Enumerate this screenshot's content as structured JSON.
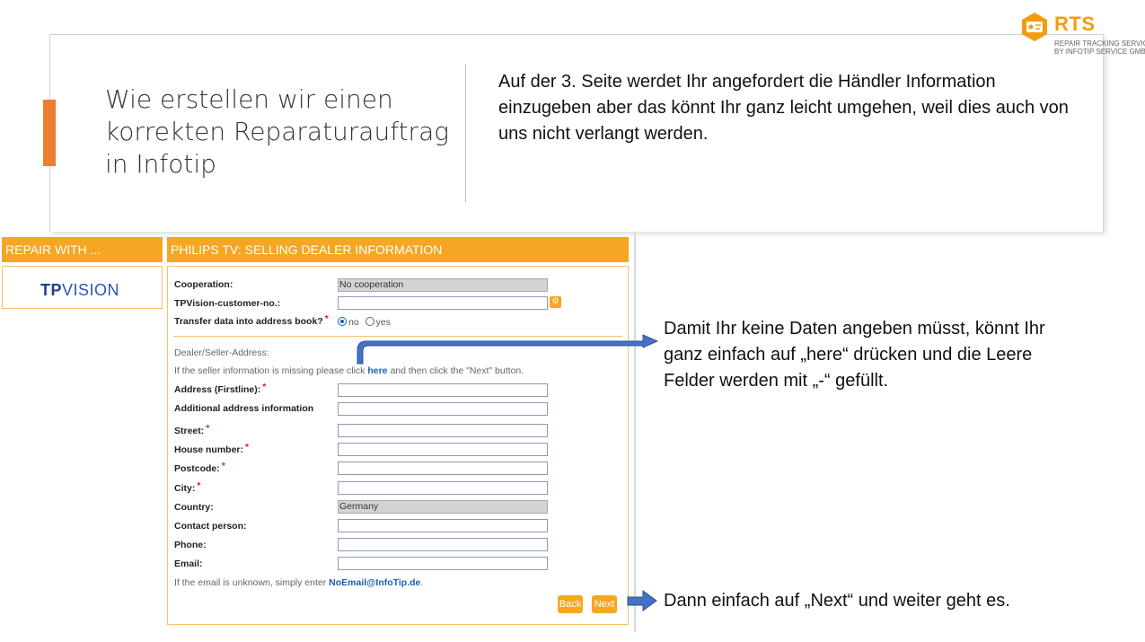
{
  "slide": {
    "title": "Wie erstellen wir einen korrekten Reparaturauftrag in Infotip",
    "intro": "Auf der 3. Seite werdet Ihr angefordert die Händler Information einzugeben aber das könnt Ihr ganz leicht umgehen, weil dies auch von uns nicht verlangt werden.",
    "note_here": "Damit Ihr keine Daten angeben müsst, könnt Ihr ganz einfach auf „here“ drücken und die Leere Felder werden mit „-“ gefüllt.",
    "note_next": "Dann einfach auf „Next“ und weiter geht es.",
    "accent_color": "#ed7d31"
  },
  "logo": {
    "name": "RTS",
    "sub_line1": "REPAIR TRACKING SERVICE",
    "sub_line2": "BY INFOTIP SERVICE GMBH",
    "color": "#f39c12"
  },
  "left_pane": {
    "header": "REPAIR WITH ...",
    "brand_bold": "TP",
    "brand_thin": "VISION"
  },
  "form": {
    "header": "PHILIPS TV: SELLING DEALER INFORMATION",
    "cooperation_label": "Cooperation:",
    "cooperation_value": "No cooperation",
    "customer_no_label": "TPVision-customer-no.:",
    "transfer_label": "Transfer data into address book?",
    "transfer_options": [
      "no",
      "yes"
    ],
    "transfer_selected": "no",
    "dealer_section": "Dealer/Seller-Address:",
    "missing_hint_before": "If the seller information is missing please click",
    "here_link": "here",
    "missing_hint_after": "and then click the \"Next\" button.",
    "address_label": "Address (Firstline):",
    "additional_label": "Additional address information",
    "street_label": "Street:",
    "house_label": "House number:",
    "postcode_label": "Postcode:",
    "city_label": "City:",
    "country_label": "Country:",
    "country_value": "Germany",
    "contact_label": "Contact person:",
    "phone_label": "Phone:",
    "email_label": "Email:",
    "email_hint_before": "If the email is unknown, simply enter",
    "email_hint_link": "NoEmail@InfoTip.de",
    "email_hint_after": ".",
    "required_mark": "*",
    "back_button": "Back",
    "next_button": "Next",
    "header_color": "#f5a623"
  }
}
